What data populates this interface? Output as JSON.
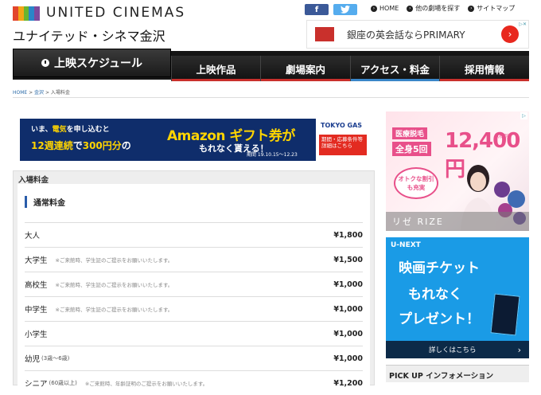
{
  "header": {
    "brand": "UNITED CINEMAS",
    "subbrand": "ユナイテッド・シネマ金沢",
    "logo_colors": [
      "#e2462c",
      "#f2a516",
      "#68b52f",
      "#2a86c8",
      "#7d4a9e"
    ],
    "social": {
      "facebook": "f",
      "twitter": ""
    },
    "links": [
      {
        "label": "HOME",
        "icon": "home-icon"
      },
      {
        "label": "他の劇場を探す",
        "icon": "search-icon"
      },
      {
        "label": "サイトマップ",
        "icon": "sitemap-icon"
      }
    ],
    "ad": {
      "text": "銀座の英会話ならPRIMARY",
      "cta_icon": "chevron-right-icon"
    }
  },
  "nav": {
    "schedule": "上映スケジュール",
    "items": [
      {
        "label": "上映作品",
        "active": false
      },
      {
        "label": "劇場案内",
        "active": false
      },
      {
        "label": "アクセス・料金",
        "active": true
      },
      {
        "label": "採用情報",
        "active": false
      }
    ]
  },
  "breadcrumb": {
    "home": "HOME",
    "sep1": " > ",
    "theater": "金沢",
    "sep2": " > ",
    "current": "入場料金"
  },
  "banner": {
    "line1a": "いま、",
    "line1b": "電気",
    "line1c": "を申し込むと",
    "line2a": "12週連続",
    "line2b": "で",
    "line2c": "300円分",
    "line2d": "の",
    "big": "Amazon ギフト券が",
    "mottl": "もれなく貰える！",
    "period": "期間 19.10.15～12.23",
    "brand": "TOKYO GAS",
    "cta": "期間・応募条件等 詳細はこちら"
  },
  "prices": {
    "title": "入場料金",
    "heading": "通常料金",
    "rows": [
      {
        "name": "大人",
        "sub": "",
        "note": "",
        "price": "¥1,800"
      },
      {
        "name": "大学生",
        "sub": "",
        "note": "※ご来館時、学生証のご提示をお願いいたします。",
        "price": "¥1,500"
      },
      {
        "name": "高校生",
        "sub": "",
        "note": "※ご来館時、学生証のご提示をお願いいたします。",
        "price": "¥1,000"
      },
      {
        "name": "中学生",
        "sub": "",
        "note": "※ご来館時、学生証のご提示をお願いいたします。",
        "price": "¥1,000"
      },
      {
        "name": "小学生",
        "sub": "",
        "note": "",
        "price": "¥1,000"
      },
      {
        "name": "幼児",
        "sub": "(3歳～6歳)",
        "note": "",
        "price": "¥1,000"
      },
      {
        "name": "シニア",
        "sub": "(60歳以上)",
        "note": "※ご来館時、年齢証明のご提示をお願いいたします。",
        "price": "¥1,200"
      }
    ]
  },
  "side_ads": {
    "rize": {
      "tag1": "医療脱毛",
      "tag2": "全身5回",
      "price": "12,400円",
      "tax": "(税別)",
      "bubble": "オトクな割引 も充実",
      "logo": "リゼ RIZE"
    },
    "unext": {
      "brand": "U-NEXT",
      "line1": "映画チケット",
      "line2": "もれなく",
      "line3": "プレゼント！",
      "more": "詳しくはこちら"
    }
  },
  "pickup": {
    "title": "PICK UP インフォメーション"
  },
  "colors": {
    "nav_bg": "#151515",
    "nav_accent_red": "#c9302c",
    "nav_accent_blue": "#3a86c8",
    "heading_bar": "#2a5caa"
  }
}
